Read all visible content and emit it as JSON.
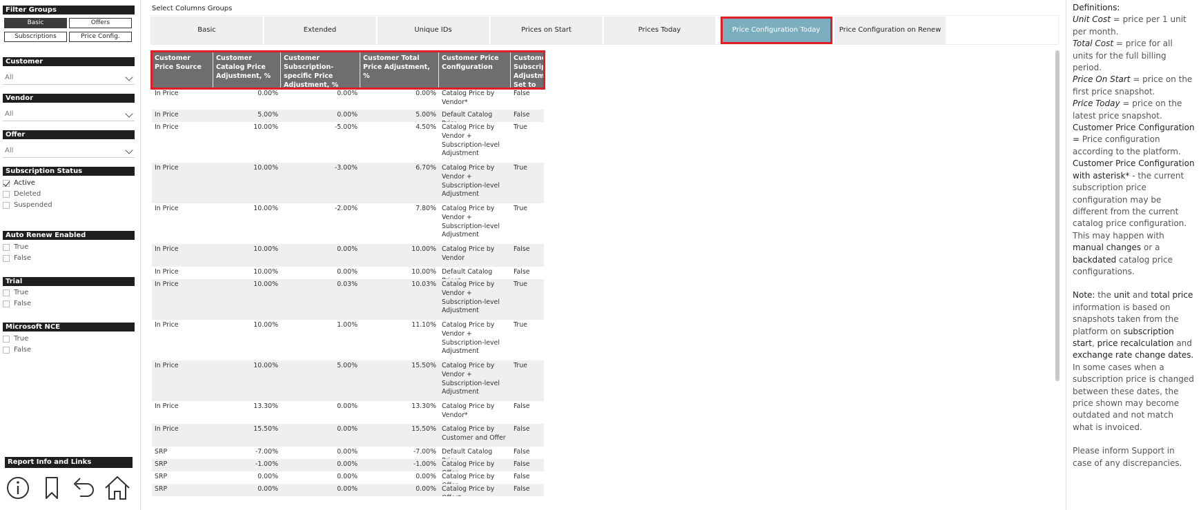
{
  "filter_groups": {
    "title": "Filter Groups",
    "buttons": [
      "Basic",
      "Offers",
      "Subscriptions",
      "Price Config."
    ]
  },
  "filters": {
    "customer": {
      "label": "Customer",
      "value": "All"
    },
    "vendor": {
      "label": "Vendor",
      "value": "All"
    },
    "offer": {
      "label": "Offer",
      "value": "All"
    },
    "subscription_status": {
      "label": "Subscription Status",
      "options": [
        "Active",
        "Deleted",
        "Suspended"
      ],
      "checked": "Active"
    },
    "auto_renew": {
      "label": "Auto Renew Enabled",
      "options": [
        "True",
        "False"
      ]
    },
    "trial": {
      "label": "Trial",
      "options": [
        "True",
        "False"
      ]
    },
    "microsoft_nce": {
      "label": "Microsoft NCE",
      "options": [
        "True",
        "False"
      ]
    }
  },
  "report_info": {
    "label": "Report Info and Links"
  },
  "nav_icons": [
    "info-icon",
    "bookmark-icon",
    "back-icon",
    "home-icon"
  ],
  "column_groups": {
    "label": "Select Columns Groups",
    "tabs": [
      "Basic",
      "Extended",
      "Unique IDs",
      "Prices on Start",
      "Prices Today",
      "Price Configuration Today",
      "Price Configuration on Renew"
    ],
    "active": "Price Configuration Today"
  },
  "table": {
    "headers": [
      "Customer Price Source",
      "Customer Catalog Price Adjustment, %",
      "Customer Subscription-specific Price Adjustment, %",
      "Customer Total Price Adjustment, %",
      "Customer Price Configuration",
      "Customer Subscription Adjustment Set to Repeat"
    ],
    "rows": [
      [
        "In Price",
        "0.00%",
        "0.00%",
        "0.00%",
        "Catalog Price by Vendor*",
        "False"
      ],
      [
        "In Price",
        "5.00%",
        "0.00%",
        "5.00%",
        "Default Catalog Price",
        "False"
      ],
      [
        "In Price",
        "10.00%",
        "-5.00%",
        "4.50%",
        "Catalog Price by Vendor + Subscription-level Adjustment",
        "True"
      ],
      [
        "In Price",
        "10.00%",
        "-3.00%",
        "6.70%",
        "Catalog Price by Vendor + Subscription-level Adjustment",
        "True"
      ],
      [
        "In Price",
        "10.00%",
        "-2.00%",
        "7.80%",
        "Catalog Price by Vendor + Subscription-level Adjustment",
        "True"
      ],
      [
        "In Price",
        "10.00%",
        "0.00%",
        "10.00%",
        "Catalog Price by Vendor",
        "False"
      ],
      [
        "In Price",
        "10.00%",
        "0.00%",
        "10.00%",
        "Default Catalog Price*",
        "False"
      ],
      [
        "In Price",
        "10.00%",
        "0.03%",
        "10.03%",
        "Catalog Price by Vendor + Subscription-level Adjustment",
        "True"
      ],
      [
        "In Price",
        "10.00%",
        "1.00%",
        "11.10%",
        "Catalog Price by Vendor + Subscription-level Adjustment",
        "True"
      ],
      [
        "In Price",
        "10.00%",
        "5.00%",
        "15.50%",
        "Catalog Price by Vendor + Subscription-level Adjustment",
        "True"
      ],
      [
        "In Price",
        "13.30%",
        "0.00%",
        "13.30%",
        "Catalog Price by Vendor*",
        "False"
      ],
      [
        "In Price",
        "15.50%",
        "0.00%",
        "15.50%",
        "Catalog Price by Customer and Offer",
        "False"
      ],
      [
        "SRP",
        "-7.00%",
        "0.00%",
        "-7.00%",
        "Default Catalog Price",
        "False"
      ],
      [
        "SRP",
        "-1.00%",
        "0.00%",
        "-1.00%",
        "Catalog Price by Offer",
        "False"
      ],
      [
        "SRP",
        "0.00%",
        "0.00%",
        "0.00%",
        "Catalog Price by Offer",
        "False"
      ],
      [
        "SRP",
        "0.00%",
        "0.00%",
        "0.00%",
        "Catalog Price by Offer*",
        "False"
      ]
    ]
  },
  "definitions": {
    "title": "Definitions:",
    "unit_cost_term": "Unit Cost",
    "unit_cost_text": " = price per 1 unit per month.",
    "total_cost_term": "Total Cost",
    "total_cost_text": " = price for all units for the full billing period.",
    "price_on_start_term": "Price On Start",
    "price_on_start_text": " = price on the first price snapshot.",
    "price_today_term": "Price Today",
    "price_today_text": " = price on the latest price snapshot.",
    "cpc_term": "Customer Price Configuration =",
    "cpc_text": " Price configuration according to the platform.",
    "cpc_asterisk_term": "Customer Price Configuration with asterisk*",
    "cpc_asterisk_text": " - the current subscription price configuration may be different from the current catalog price configuration.",
    "may_happen_text": "This may happen with ",
    "manual_changes": "manual changes",
    "or_a": " or a ",
    "backdated": "backdated",
    "catalog_configs": " catalog price configurations.",
    "note_term": "Note:",
    "note_text_1": " the ",
    "unit_word": "unit",
    "and_word": " and ",
    "total_price": "total price",
    "note_text_2": " information is based on snapshots taken from the platform on ",
    "subscription_start": "subscription start",
    "comma": ",",
    "price_recalculation": "price recalculation",
    "and_word2": " and ",
    "exchange_rate": "exchange rate change dates.",
    "note_text_3": " In some cases when a subscription price is changed between these dates, the price shown may become outdated and not match what is invoiced.",
    "support_text": "Please inform Support in case of any discrepancies."
  }
}
